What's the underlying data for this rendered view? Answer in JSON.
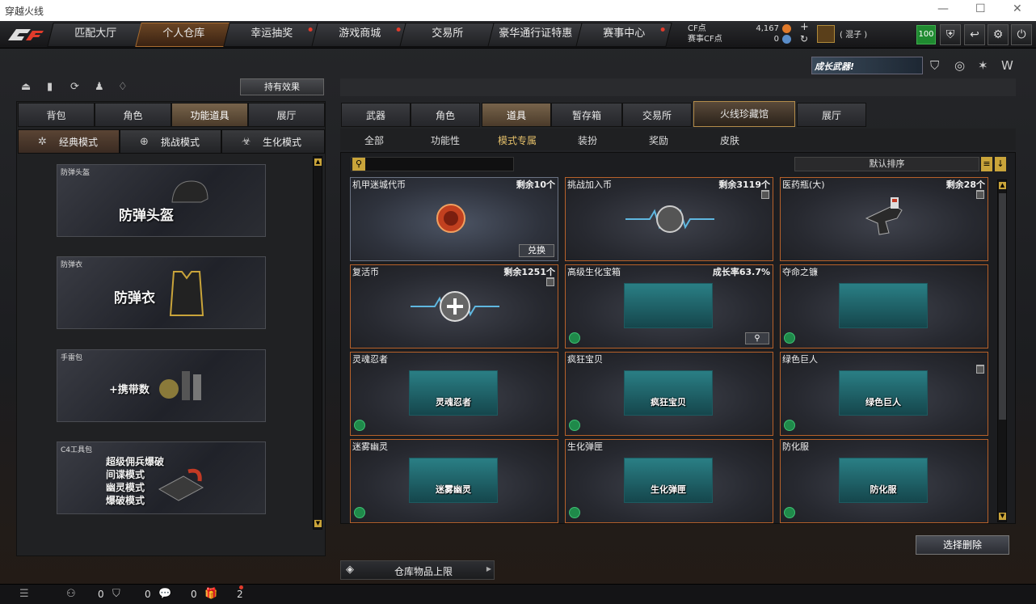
{
  "window": {
    "title": "穿越火线"
  },
  "nav": {
    "tabs": [
      {
        "label": "匹配大厅"
      },
      {
        "label": "个人仓库"
      },
      {
        "label": "幸运抽奖"
      },
      {
        "label": "游戏商城"
      },
      {
        "label": "交易所"
      },
      {
        "label": "豪华通行证特惠"
      },
      {
        "label": "赛事中心"
      }
    ]
  },
  "currency": {
    "cf_label": "CF点",
    "cf_value": "4,167",
    "match_cf_label": "赛事CF点",
    "match_cf_value": "0"
  },
  "user": {
    "name": "( 混子 )",
    "level": "100"
  },
  "banner": {
    "text": "成长武器!"
  },
  "left": {
    "effects_button": "持有效果",
    "tabs": [
      {
        "label": "背包"
      },
      {
        "label": "角色"
      },
      {
        "label": "功能道具"
      },
      {
        "label": "展厅"
      }
    ],
    "modes": [
      {
        "label": "经典模式"
      },
      {
        "label": "挑战模式"
      },
      {
        "label": "生化模式"
      }
    ],
    "items": [
      {
        "label": "防弹头盔",
        "big": "防弹头盔"
      },
      {
        "label": "防弹衣",
        "big": "防弹衣"
      },
      {
        "label": "手雷包",
        "big": "+携带数"
      },
      {
        "label": "C4工具包",
        "big1": "超级佣兵爆破",
        "big2": "间谍模式",
        "big3": "幽灵模式",
        "big4": "爆破模式"
      }
    ]
  },
  "right": {
    "tabs": [
      {
        "label": "武器"
      },
      {
        "label": "角色"
      },
      {
        "label": "道具"
      },
      {
        "label": "暂存箱"
      },
      {
        "label": "交易所"
      },
      {
        "label": "火线珍藏馆"
      },
      {
        "label": "展厅"
      }
    ],
    "filters": [
      {
        "label": "全部"
      },
      {
        "label": "功能性"
      },
      {
        "label": "模式专属"
      },
      {
        "label": "装扮"
      },
      {
        "label": "奖励"
      },
      {
        "label": "皮肤"
      }
    ],
    "sort_label": "默认排序",
    "search_placeholder": "",
    "cards": [
      {
        "name": "机甲迷城代币",
        "remain": "剩余10个",
        "action": "兑换"
      },
      {
        "name": "挑战加入币",
        "remain": "剩余3119个"
      },
      {
        "name": "医药瓶(大)",
        "remain": "剩余28个"
      },
      {
        "name": "复活币",
        "remain": "剩余1251个"
      },
      {
        "name": "高级生化宝箱",
        "remain": "成长率63.7%"
      },
      {
        "name": "夺命之镰",
        "remain": ""
      },
      {
        "name": "灵魂忍者",
        "pic": "灵魂忍者"
      },
      {
        "name": "疯狂宝贝",
        "pic": "疯狂宝贝"
      },
      {
        "name": "绿色巨人",
        "pic": "绿色巨人"
      },
      {
        "name": "迷雾幽灵",
        "pic": "迷雾幽灵"
      },
      {
        "name": "生化弹匣",
        "pic": "生化弹匣"
      },
      {
        "name": "防化服",
        "pic": "防化服"
      }
    ],
    "delete_button": "选择删除",
    "limit_label": "仓库物品上限"
  },
  "footer": {
    "count1": "0",
    "count2": "0",
    "count3": "0",
    "count4": "2"
  },
  "colors": {
    "accent": "#b7612a",
    "active_tab": "#6a4524",
    "gold": "#e5c06a"
  }
}
